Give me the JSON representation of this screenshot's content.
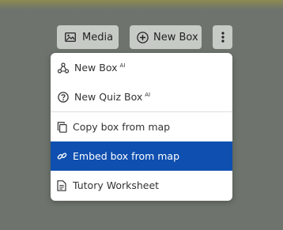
{
  "toolbar": {
    "media_label": "Media",
    "new_box_label": "New Box"
  },
  "menu": {
    "items": [
      {
        "label": "New Box",
        "badge": "AI",
        "icon": "share-nodes-icon"
      },
      {
        "label": "New Quiz Box",
        "badge": "AI",
        "icon": "question-circle-icon"
      },
      {
        "label": "Copy box from map",
        "icon": "copy-icon"
      },
      {
        "label": "Embed box from map",
        "icon": "link-icon",
        "highlighted": true
      },
      {
        "label": "Tutory Worksheet",
        "icon": "document-icon"
      }
    ]
  },
  "colors": {
    "background": "#6e746d",
    "button": "#c6cbc6",
    "highlight": "#0e4fb0"
  }
}
